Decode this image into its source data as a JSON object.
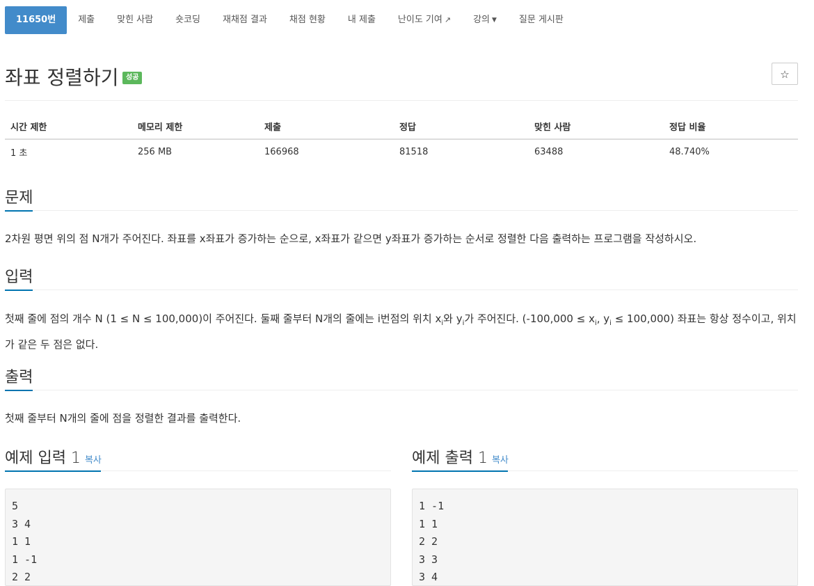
{
  "nav": {
    "items": [
      {
        "label": "11650번",
        "active": true
      },
      {
        "label": "제출"
      },
      {
        "label": "맞힌 사람"
      },
      {
        "label": "숏코딩"
      },
      {
        "label": "재채점 결과"
      },
      {
        "label": "채점 현황"
      },
      {
        "label": "내 제출"
      },
      {
        "label": "난이도 기여",
        "icon": "external-link-icon"
      },
      {
        "label": "강의",
        "icon": "caret-down-icon"
      },
      {
        "label": "질문 게시판"
      }
    ]
  },
  "problem": {
    "title": "좌표 정렬하기",
    "badge": "성공",
    "star_icon": "☆"
  },
  "info": {
    "headers": [
      "시간 제한",
      "메모리 제한",
      "제출",
      "정답",
      "맞힌 사람",
      "정답 비율"
    ],
    "values": [
      "1 초",
      "256 MB",
      "166968",
      "81518",
      "63488",
      "48.740%"
    ]
  },
  "sections": {
    "description_title": "문제",
    "description": "2차원 평면 위의 점 N개가 주어진다. 좌표를 x좌표가 증가하는 순으로, x좌표가 같으면 y좌표가 증가하는 순서로 정렬한 다음 출력하는 프로그램을 작성하시오.",
    "input_title": "입력",
    "input": {
      "part1": "첫째 줄에 점의 개수 N (1 ≤ N ≤ 100,000)이 주어진다. 둘째 줄부터 N개의 줄에는 i번점의 위치 x",
      "sub_i": "i",
      "part2": "와 y",
      "part3": "가 주어진다. (-100,000 ≤ x",
      "part4": ", y",
      "part5": " ≤ 100,000) 좌표는 항상 정수이고, 위치가 같은 두 점은 없다."
    },
    "output_title": "출력",
    "output": "첫째 줄부터 N개의 줄에 점을 정렬한 결과를 출력한다."
  },
  "samples": {
    "input_title": "예제 입력 1",
    "output_title": "예제 출력 1",
    "copy_label": "복사",
    "input_text": "5\n3 4\n1 1\n1 -1\n2 2",
    "output_text": "1 -1\n1 1\n2 2\n3 3\n3 4"
  }
}
